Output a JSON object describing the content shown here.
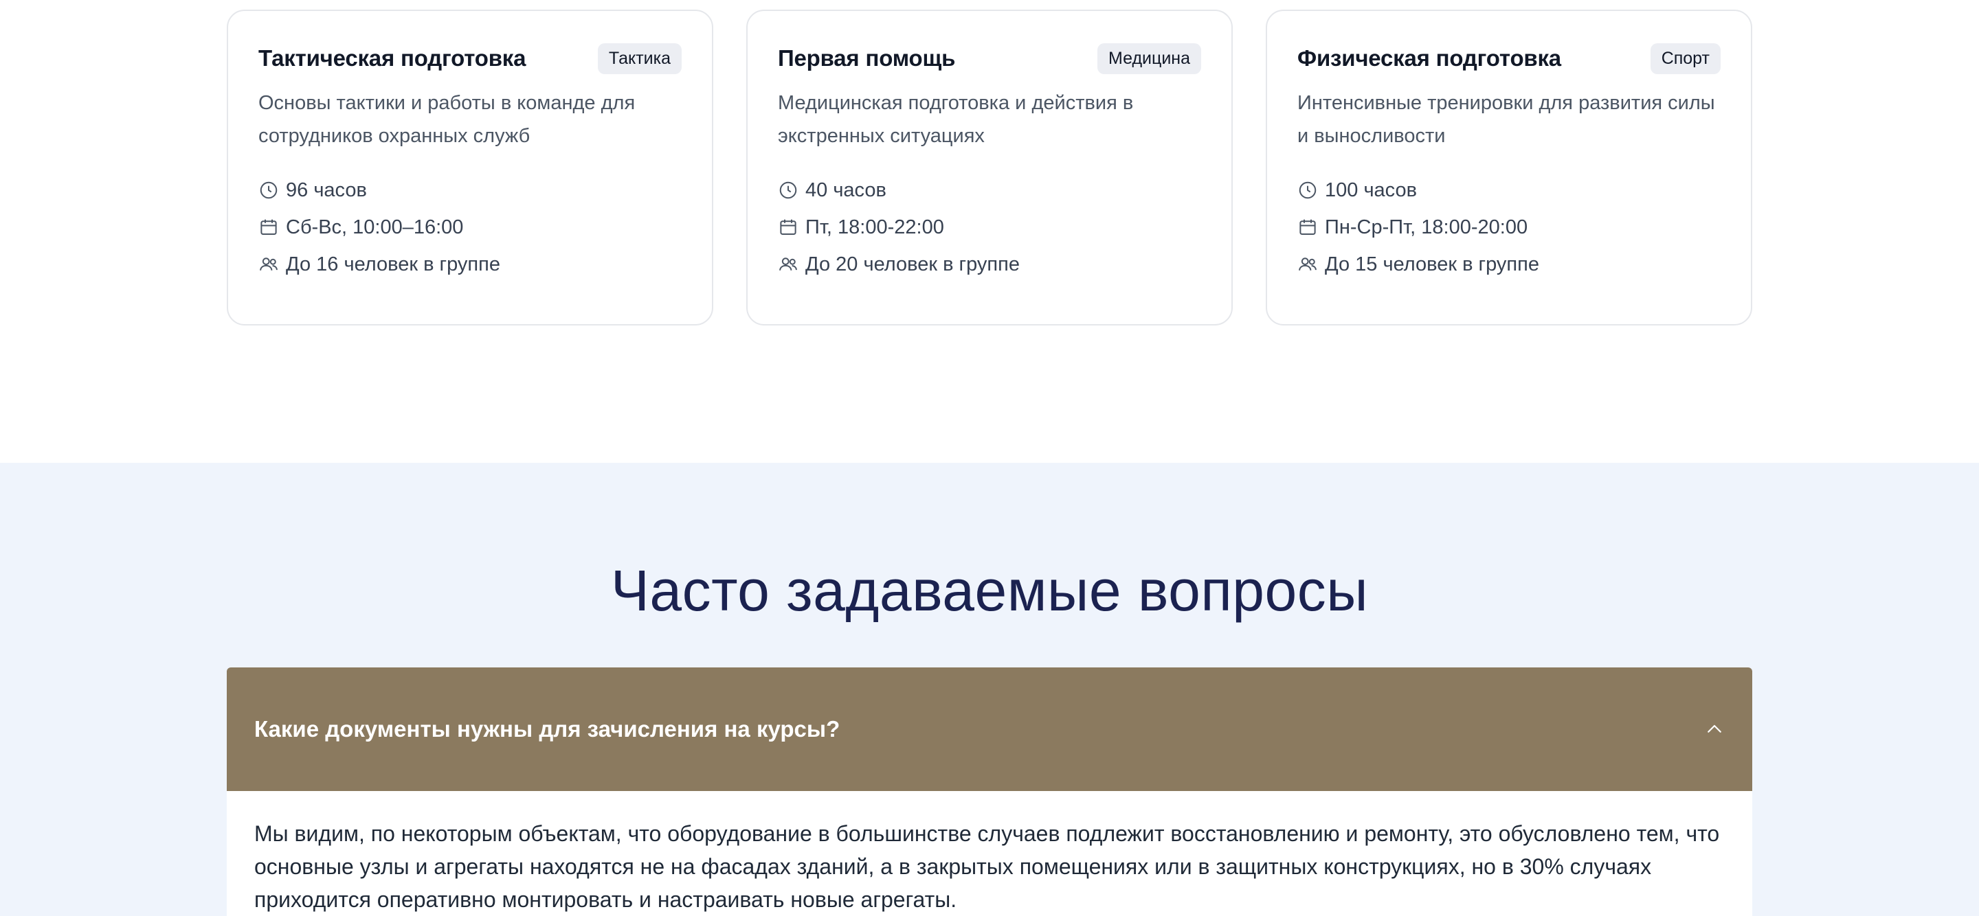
{
  "courses": [
    {
      "title": "Тактическая подготовка",
      "badge": "Тактика",
      "description": "Основы тактики и работы в команде для сотрудников охранных служб",
      "hours": "96 часов",
      "schedule": "Сб-Вс, 10:00–16:00",
      "group": "До 16 человек в группе"
    },
    {
      "title": "Первая помощь",
      "badge": "Медицина",
      "description": "Медицинская подготовка и действия в экстренных ситуациях",
      "hours": "40 часов",
      "schedule": "Пт, 18:00-22:00",
      "group": "До 20 человек в группе"
    },
    {
      "title": "Физическая подготовка",
      "badge": "Спорт",
      "description": "Интенсивные тренировки для развития силы и выносливости",
      "hours": "100 часов",
      "schedule": "Пн-Ср-Пт, 18:00-20:00",
      "group": "До 15 человек в группе"
    }
  ],
  "icons": {
    "hours": "clock-icon",
    "schedule": "calendar-icon",
    "group": "users-icon",
    "faq_toggle": "chevron-up-icon"
  },
  "faq": {
    "title": "Часто задаваемые вопросы",
    "items": [
      {
        "question": "Какие документы нужны для зачисления на курсы?",
        "answer": "Мы видим, по некоторым объектам, что оборудование в большинстве случаев подлежит восстановлению и ремонту, это обусловлено тем, что основные узлы и агрегаты находятся не на фасадах зданий, а в закрытых помещениях или в защитных конструкциях, но в 30% случаях приходится оперативно монтировать и настраивать новые агрегаты."
      }
    ]
  },
  "colors": {
    "faq_accent": "#8b7a5f",
    "faq_background": "#eff4fc",
    "heading": "#1b2250"
  }
}
